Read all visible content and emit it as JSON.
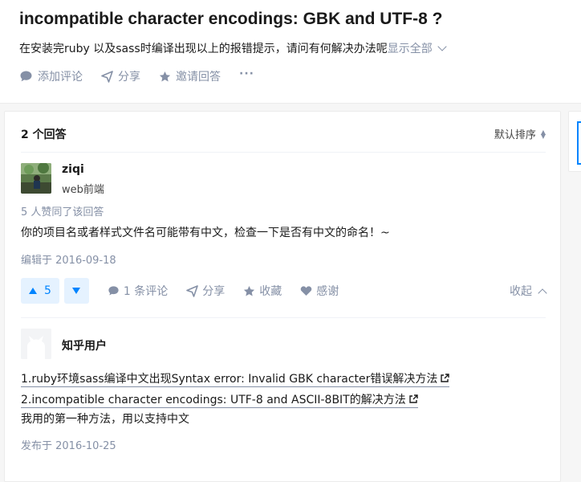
{
  "question": {
    "title": "incompatible character encodings: GBK and UTF-8 ?",
    "description": "在安装完ruby 以及sass时编译出现以上的报错提示，请问有何解决办法呢",
    "show_all": "显示全部",
    "actions": {
      "comment": "添加评论",
      "share": "分享",
      "invite": "邀请回答",
      "more": "···"
    }
  },
  "answers_header": {
    "count_label": "2 个回答",
    "sort_label": "默认排序"
  },
  "answers": [
    {
      "author_name": "ziqi",
      "author_bio": "web前端",
      "votes_note": "5 人赞同了该回答",
      "content": "你的项目名或者样式文件名可能带有中文，检查一下是否有中文的命名！~",
      "date": "编辑于 2016-09-18",
      "vote_count": "5",
      "actions": {
        "comments": "1 条评论",
        "share": "分享",
        "favorite": "收藏",
        "thanks": "感谢",
        "collapse": "收起"
      }
    },
    {
      "author_name": "知乎用户",
      "links": [
        "1.ruby环境sass编译中文出现Syntax error: Invalid GBK character错误解决方法",
        "2.incompatible character encodings: UTF-8 and ASCII-8BIT的解决方法"
      ],
      "content": "我用的第一种方法，用以支持中文",
      "date": "发布于 2016-10-25"
    }
  ],
  "colors": {
    "accent": "#0084ff",
    "muted": "#8590a6",
    "vote_bg": "#e5f2ff"
  }
}
